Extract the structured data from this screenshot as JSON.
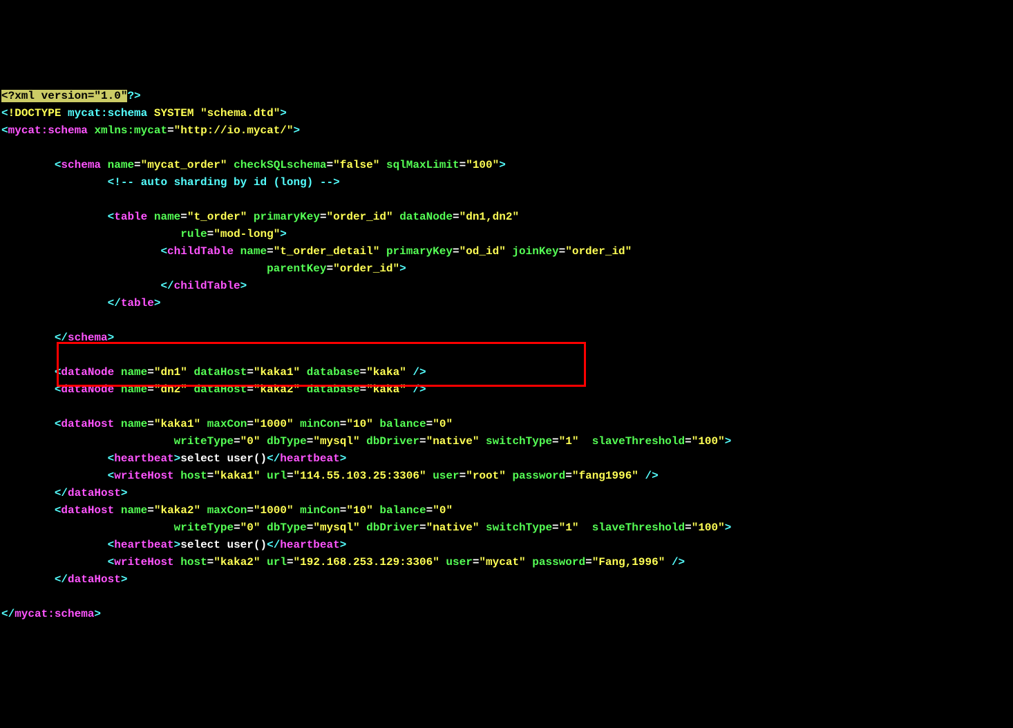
{
  "xml_declaration": {
    "open": "<?",
    "content": "xml version=\"1.0\"",
    "close": "?>"
  },
  "doctype": {
    "open": "<",
    "bang": "!DOCTYPE",
    "name": " mycat:schema ",
    "system": "SYSTEM",
    "file": "schema.dtd",
    "close": ">"
  },
  "root": {
    "open_lt": "<",
    "name": "mycat:schema",
    "xmlns_attr": "xmlns:mycat",
    "xmlns_val": "http://io.mycat/",
    "close_gt": ">"
  },
  "schema": {
    "tag": "schema",
    "name_attr": "name",
    "name_val": "mycat_order",
    "check_attr": "checkSQLschema",
    "check_val": "false",
    "limit_attr": "sqlMaxLimit",
    "limit_val": "100",
    "comment": "<!-- auto sharding by id (long) -->"
  },
  "table": {
    "tag": "table",
    "name_attr": "name",
    "name_val": "t_order",
    "pk_attr": "primaryKey",
    "pk_val": "order_id",
    "dn_attr": "dataNode",
    "dn_val": "dn1,dn2",
    "rule_attr": "rule",
    "rule_val": "mod-long"
  },
  "childTable": {
    "tag": "childTable",
    "name_attr": "name",
    "name_val": "t_order_detail",
    "pk_attr": "primaryKey",
    "pk_val": "od_id",
    "jk_attr": "joinKey",
    "jk_val": "order_id",
    "parent_attr": "parentKey",
    "parent_val": "order_id"
  },
  "dataNode1": {
    "tag": "dataNode",
    "name_val": "dn1",
    "host_val": "kaka1",
    "db_val": "kaka"
  },
  "dataNode2": {
    "tag": "dataNode",
    "name_val": "dn2",
    "host_val": "kaka2",
    "db_val": "kaka"
  },
  "labels": {
    "name": "name",
    "dataHost": "dataHost",
    "database": "database",
    "maxCon": "maxCon",
    "minCon": "minCon",
    "balance": "balance",
    "writeType": "writeType",
    "dbType": "dbType",
    "dbDriver": "dbDriver",
    "switchType": "switchType",
    "slaveThreshold": "slaveThreshold",
    "host": "host",
    "url": "url",
    "user": "user",
    "password": "password",
    "heartbeat": "heartbeat",
    "writeHost": "writeHost"
  },
  "dataHost1": {
    "tag": "dataHost",
    "name_val": "kaka1",
    "maxCon": "1000",
    "minCon": "10",
    "balance": "0",
    "writeType": "0",
    "dbType": "mysql",
    "dbDriver": "native",
    "switchType": "1",
    "slaveThreshold": "100",
    "heartbeat_text": "select user()",
    "wh_host": "kaka1",
    "wh_url": "114.55.103.25:3306",
    "wh_user": "root",
    "wh_password": "fang1996"
  },
  "dataHost2": {
    "tag": "dataHost",
    "name_val": "kaka2",
    "maxCon": "1000",
    "minCon": "10",
    "balance": "0",
    "writeType": "0",
    "dbType": "mysql",
    "dbDriver": "native",
    "switchType": "1",
    "slaveThreshold": "100",
    "heartbeat_text": "select user()",
    "wh_host": "kaka2",
    "wh_url": "192.168.253.129:3306",
    "wh_user": "mycat",
    "wh_password": "Fang,1996"
  },
  "close": {
    "schema": "</schema>",
    "table": "</table>",
    "childTable": "</childTable>",
    "dataHost": "</dataHost>",
    "mycat": "mycat:schema"
  }
}
